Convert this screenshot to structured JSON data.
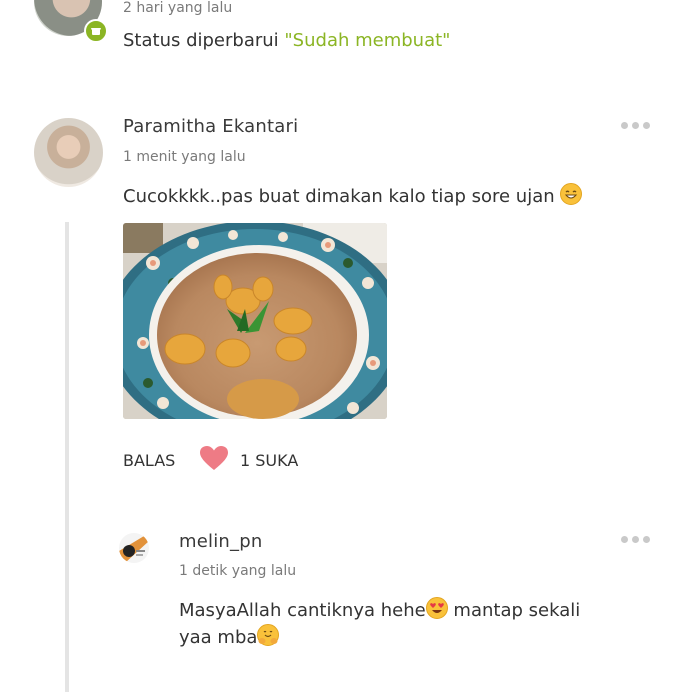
{
  "status_activity": {
    "time": "2 hari yang lalu",
    "status_prefix": "Status diperbarui",
    "status_value": "\"Sudah membuat\""
  },
  "comment": {
    "author": "Paramitha Ekantari",
    "time": "1 menit yang lalu",
    "text": "Cucokkkk..pas buat dimakan kalo tiap sore ujan",
    "emoji_icon": "grinning-face-icon",
    "actions": {
      "reply_label": "BALAS",
      "like_count_label": "1 SUKA"
    }
  },
  "reply": {
    "author": "melin_pn",
    "time": "1 detik yang lalu",
    "text_part1": "MasyaAllah cantiknya hehe",
    "text_part2": " mantap sekali",
    "text_line2": "yaa mba",
    "emoji1_icon": "heart-eyes-face-icon",
    "emoji2_icon": "hugging-face-icon"
  },
  "colors": {
    "accent_green": "#8bb524",
    "heart_pink": "#ee7b85",
    "thread_line": "#e4e4e4"
  }
}
